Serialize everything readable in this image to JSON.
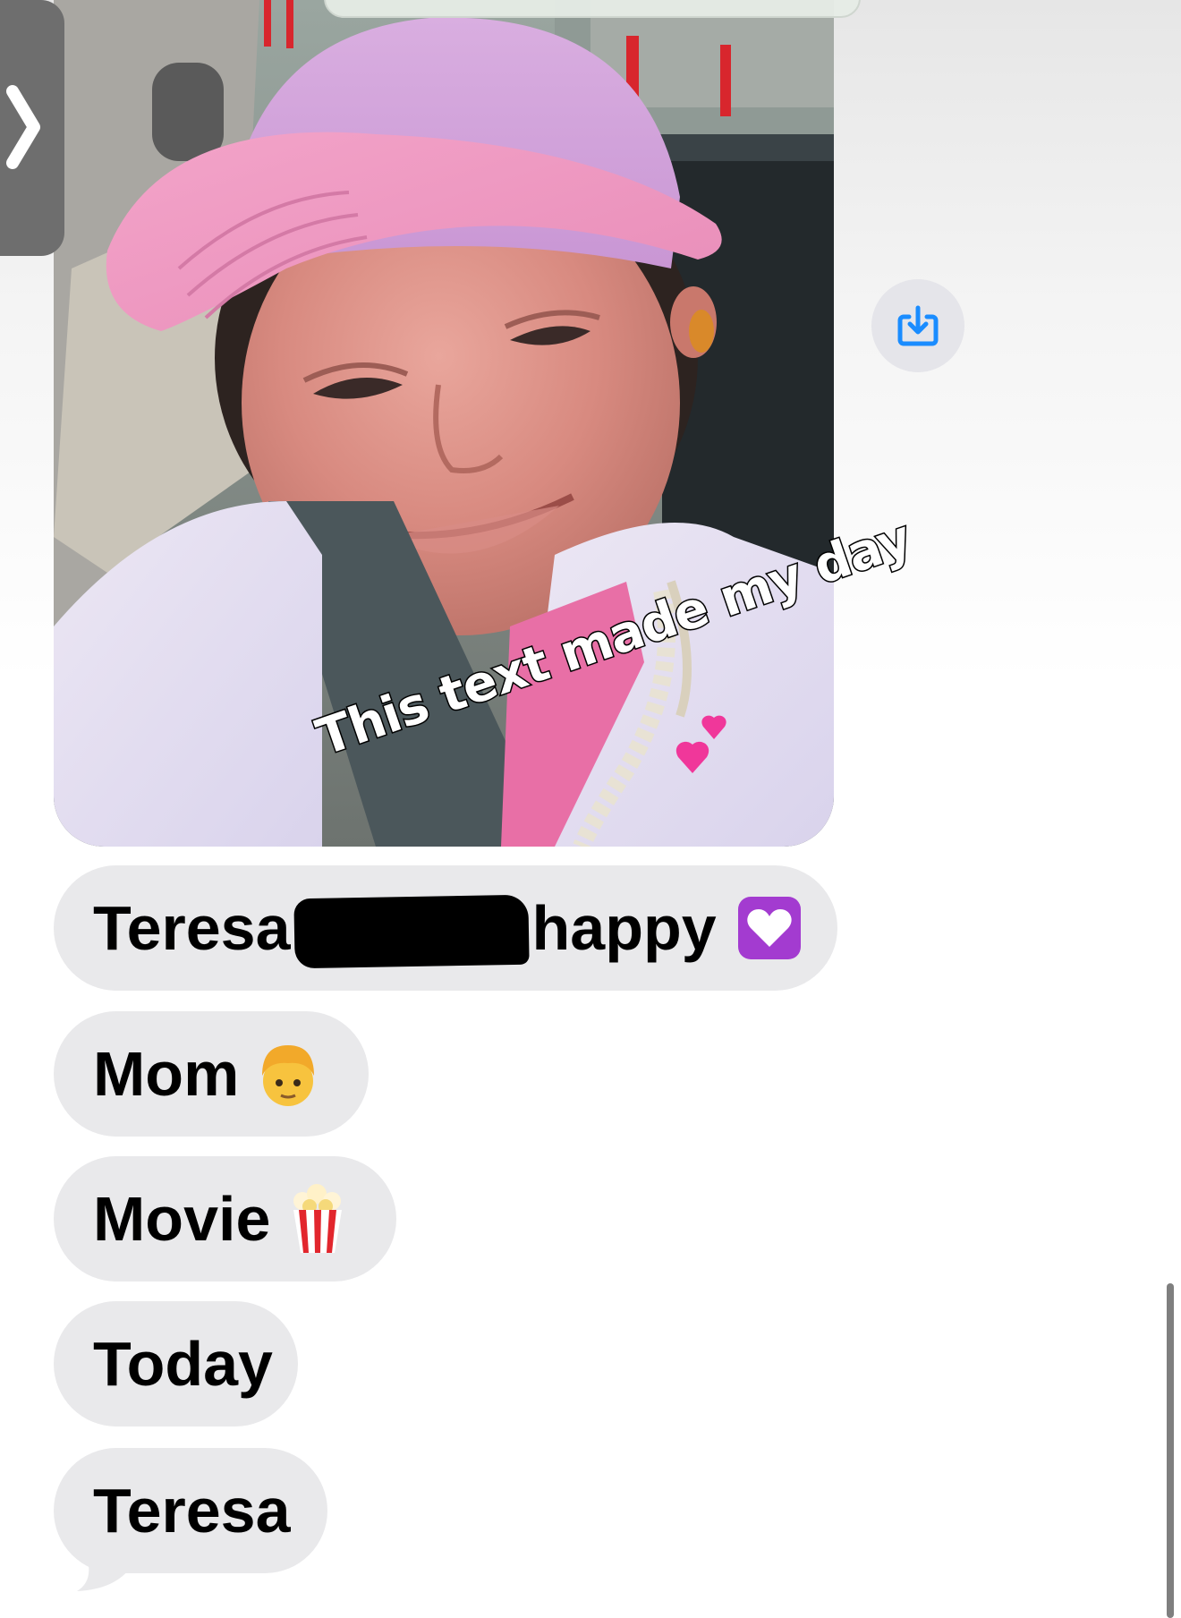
{
  "photo_message": {
    "caption": "This text made my day",
    "caption_emoji": "two-hearts"
  },
  "messages": [
    {
      "before_redaction": "Teresa",
      "after_redaction": "happy",
      "emoji": "purple-heart"
    },
    {
      "text": "Mom",
      "emoji": "person-blond"
    },
    {
      "text": "Movie",
      "emoji": "popcorn"
    },
    {
      "text": "Today"
    },
    {
      "text": "Teresa"
    }
  ],
  "colors": {
    "bubble": "#e9e9eb",
    "accent_blue": "#1a8cff",
    "text": "#000000"
  }
}
